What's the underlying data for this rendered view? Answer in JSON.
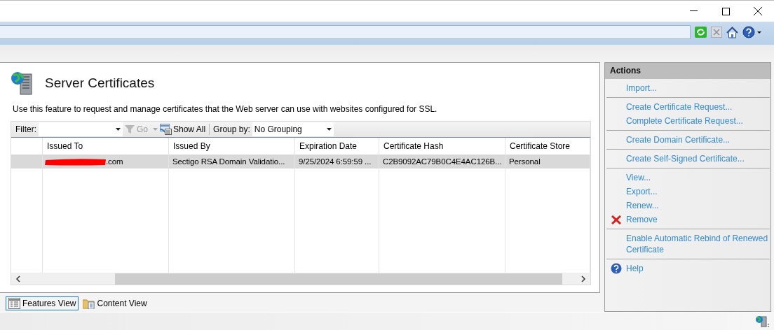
{
  "header": {
    "title": "Server Certificates",
    "description": "Use this feature to request and manage certificates that the Web server can use with websites configured for SSL."
  },
  "toolbar": {
    "filter_label": "Filter:",
    "go": "Go",
    "show_all": "Show All",
    "group_by_label": "Group by:",
    "group_by_value": "No Grouping"
  },
  "table": {
    "columns": [
      "Issued To",
      "Issued By",
      "Expiration Date",
      "Certificate Hash",
      "Certificate Store"
    ],
    "rows": [
      {
        "selected": true,
        "redacted": true,
        "cells": [
          ".com",
          "Sectigo RSA Domain Validatio...",
          "9/25/2024 6:59:59 ...",
          "C2B9092AC79B0C4E4AC126B...",
          "Personal"
        ]
      }
    ]
  },
  "view_tabs": [
    {
      "label": "Features View",
      "selected": true,
      "kind": "features"
    },
    {
      "label": "Content View",
      "selected": false,
      "kind": "content"
    }
  ],
  "actions": {
    "title": "Actions",
    "groups": [
      [
        {
          "label": "Import...",
          "kind": "plain"
        }
      ],
      [
        {
          "label": "Create Certificate Request...",
          "kind": "plain"
        },
        {
          "label": "Complete Certificate Request...",
          "kind": "plain"
        }
      ],
      [
        {
          "label": "Create Domain Certificate...",
          "kind": "plain"
        }
      ],
      [
        {
          "label": "Create Self-Signed Certificate...",
          "kind": "plain"
        }
      ],
      [
        {
          "label": "View...",
          "kind": "plain"
        },
        {
          "label": "Export...",
          "kind": "plain"
        },
        {
          "label": "Renew...",
          "kind": "plain"
        },
        {
          "label": "Remove",
          "kind": "delete"
        }
      ],
      [
        {
          "label": "Enable Automatic Rebind of Renewed Certificate",
          "kind": "plain"
        }
      ],
      [
        {
          "label": "Help",
          "kind": "help"
        }
      ]
    ]
  }
}
